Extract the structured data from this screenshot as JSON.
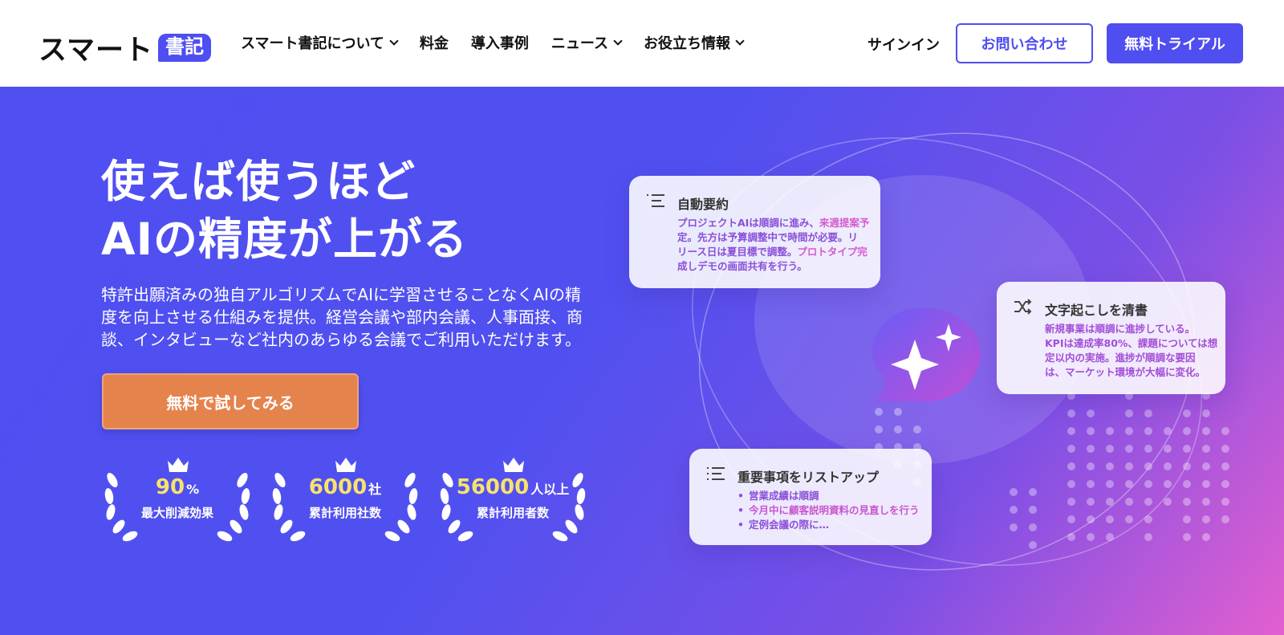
{
  "header": {
    "logo_text": "スマート",
    "logo_badge": "書記",
    "nav": [
      {
        "label": "スマート書記について",
        "dropdown": true
      },
      {
        "label": "料金",
        "dropdown": false
      },
      {
        "label": "導入事例",
        "dropdown": false
      },
      {
        "label": "ニュース",
        "dropdown": true
      },
      {
        "label": "お役立ち情報",
        "dropdown": true
      }
    ],
    "signin": "サインイン",
    "contact": "お問い合わせ",
    "trial": "無料トライアル"
  },
  "hero": {
    "title_line1": "使えば使うほど",
    "title_line2": "AIの精度が上がる",
    "desc_line1": "特許出願済みの独自アルゴリズムでAIに学習させることなくAIの精",
    "desc_line2": "度を向上させる仕組みを提供。経営会議や部内会議、人事面接、商",
    "desc_line3": "談、インタビューなど社内のあらゆる会議でご利用いただけます。",
    "cta": "無料で試してみる"
  },
  "awards": [
    {
      "num": "90",
      "unit": "%",
      "caption": "最大削減効果"
    },
    {
      "num": "6000",
      "unit": "社",
      "caption": "累計利用社数"
    },
    {
      "num": "56000",
      "unit": "人以上",
      "caption": "累計利用者数"
    }
  ],
  "cards": {
    "summary": {
      "title": "自動要約",
      "l1a": "プロジェクトAIは順調に進み、",
      "l1b": "来週提案予",
      "l2": "定。先方は予算調整中で時間が必要。リ",
      "l3a": "リース日は夏目標で調整。",
      "l3b": "プロトタイプ完",
      "l4": "成しデモの画面共有を行う。"
    },
    "transcribe": {
      "title": "文字起こしを清書",
      "l1": "新規事業は順調に進捗している。",
      "l2": "KPIは達成率80%、課題については想",
      "l3": "定以内の実施。進捗が順調な要因",
      "l4": "は、マーケット環境が大幅に変化。"
    },
    "keypoints": {
      "title": "重要事項をリストアップ",
      "items": [
        "営業成績は順調",
        "今月中に顧客説明資料の見直しを行う",
        "定例会議の際に…"
      ]
    }
  },
  "colors": {
    "accent": "#4f4ef0",
    "cta": "#e5834c",
    "highlight": "#f6e36b"
  }
}
